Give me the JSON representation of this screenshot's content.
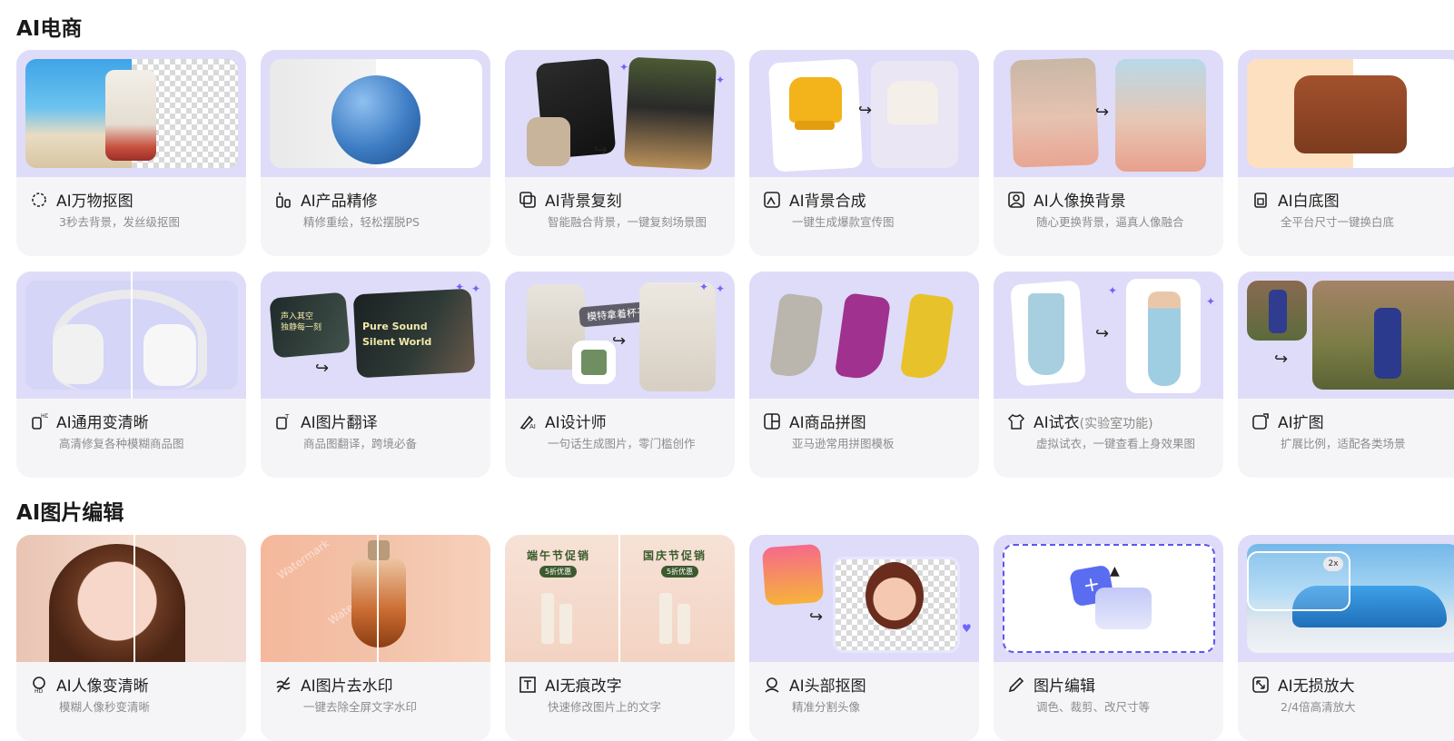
{
  "sections": [
    {
      "title": "AI电商",
      "cards": [
        {
          "icon": "cutout-icon",
          "title": "AI万物抠图",
          "tag": "",
          "desc": "3秒去背景，发丝级抠图"
        },
        {
          "icon": "retouch-icon",
          "title": "AI产品精修",
          "tag": "",
          "desc": "精修重绘，轻松摆脱PS"
        },
        {
          "icon": "layers-icon",
          "title": "AI背景复刻",
          "tag": "",
          "desc": "智能融合背景，一键复刻场景图"
        },
        {
          "icon": "compose-icon",
          "title": "AI背景合成",
          "tag": "",
          "desc": "一键生成爆款宣传图"
        },
        {
          "icon": "portrait-bg-icon",
          "title": "AI人像换背景",
          "tag": "",
          "desc": "随心更换背景，逼真人像融合"
        },
        {
          "icon": "white-bg-icon",
          "title": "AI白底图",
          "tag": "",
          "desc": "全平台尺寸一键换白底"
        }
      ]
    },
    {
      "title": "",
      "cards": [
        {
          "icon": "enhance-icon",
          "title": "AI通用变清晰",
          "tag": "",
          "desc": "高清修复各种模糊商品图"
        },
        {
          "icon": "translate-icon",
          "title": "AI图片翻译",
          "tag": "",
          "desc": "商品图翻译，跨境必备",
          "thumb_texts": [
            "声入其空\n独静每一刻",
            "Pure Sound\nSilent World"
          ]
        },
        {
          "icon": "designer-icon",
          "title": "AI设计师",
          "tag": "",
          "desc": "一句话生成图片，零门槛创作",
          "thumb_texts": [
            "模特拿着杯子"
          ]
        },
        {
          "icon": "collage-icon",
          "title": "AI商品拼图",
          "tag": "",
          "desc": "亚马逊常用拼图模板"
        },
        {
          "icon": "tryon-icon",
          "title": "AI试衣",
          "tag": "(实验室功能)",
          "desc": "虚拟试衣，一键查看上身效果图"
        },
        {
          "icon": "expand-icon",
          "title": "AI扩图",
          "tag": "",
          "desc": "扩展比例，适配各类场景"
        }
      ]
    },
    {
      "title": "AI图片编辑",
      "cards": [
        {
          "icon": "face-hd-icon",
          "title": "AI人像变清晰",
          "tag": "",
          "desc": "模糊人像秒变清晰"
        },
        {
          "icon": "watermark-remove-icon",
          "title": "AI图片去水印",
          "tag": "",
          "desc": "一键去除全屏文字水印",
          "thumb_texts": [
            "Watermark"
          ]
        },
        {
          "icon": "text-edit-icon",
          "title": "AI无痕改字",
          "tag": "",
          "desc": "快速修改图片上的文字",
          "thumb_texts": [
            "端午节促销",
            "5折优惠",
            "国庆节促销",
            "5折优惠"
          ]
        },
        {
          "icon": "head-cutout-icon",
          "title": "AI头部抠图",
          "tag": "",
          "desc": "精准分割头像"
        },
        {
          "icon": "pencil-icon",
          "title": "图片编辑",
          "tag": "",
          "desc": "调色、裁剪、改尺寸等"
        },
        {
          "icon": "upscale-icon",
          "title": "AI无损放大",
          "tag": "",
          "desc": "2/4倍高清放大",
          "thumb_texts": [
            "2x"
          ]
        }
      ]
    }
  ],
  "colors": {
    "accent": "#6f63ff",
    "thumb_bg": "#dedcf8",
    "card_bg": "#f5f5f7"
  }
}
